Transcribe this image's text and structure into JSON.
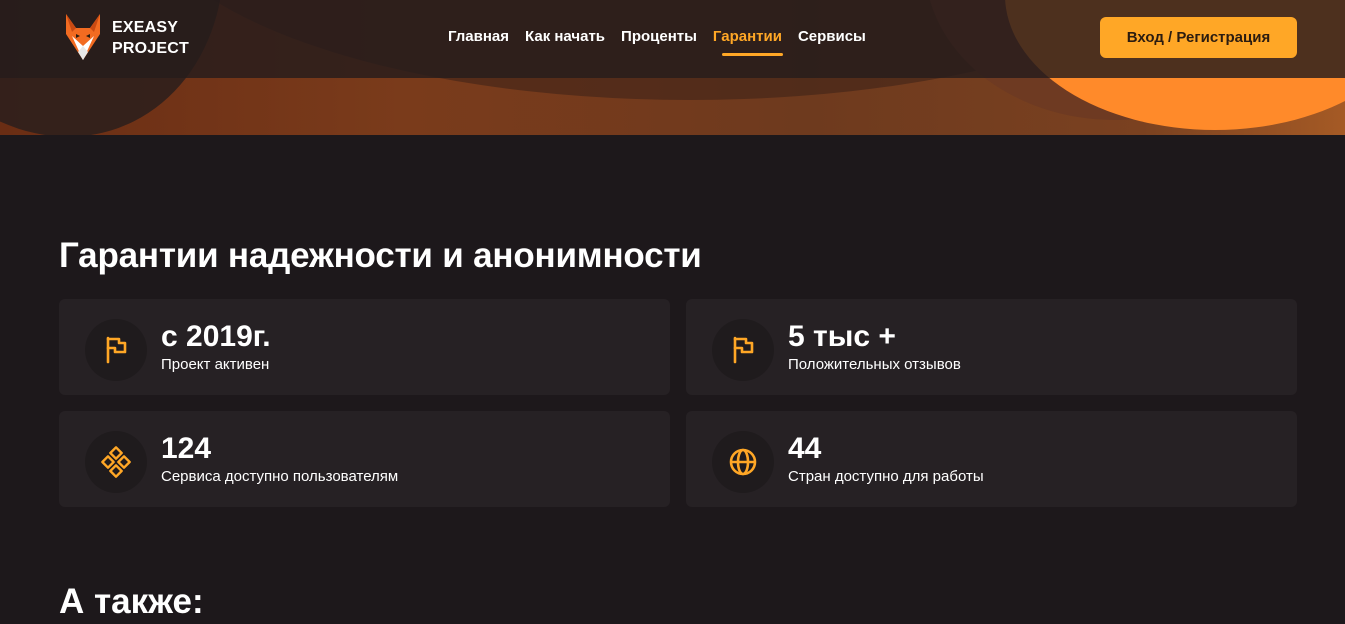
{
  "brand": {
    "line1": "EXEASY",
    "line2": "PROJECT"
  },
  "nav": [
    {
      "label": "Главная",
      "active": false
    },
    {
      "label": "Как начать",
      "active": false
    },
    {
      "label": "Проценты",
      "active": false
    },
    {
      "label": "Гарантии",
      "active": true
    },
    {
      "label": "Сервисы",
      "active": false
    }
  ],
  "login_label": "Вход / Регистрация",
  "guarantees": {
    "title": "Гарантии надежности и анонимности",
    "cards": [
      {
        "icon": "flag-icon",
        "value": "с 2019г.",
        "label": "Проект активен"
      },
      {
        "icon": "flag-icon",
        "value": "5 тыс +",
        "label": "Положительных отзывов"
      },
      {
        "icon": "grid-diamond-icon",
        "value": "124",
        "label": "Сервиса доступно пользователям"
      },
      {
        "icon": "globe-icon",
        "value": "44",
        "label": "Стран доступно для работы"
      }
    ]
  },
  "also_title": "А также:",
  "colors": {
    "accent": "#ffa726",
    "background": "#1d181b",
    "card": "#262124"
  }
}
